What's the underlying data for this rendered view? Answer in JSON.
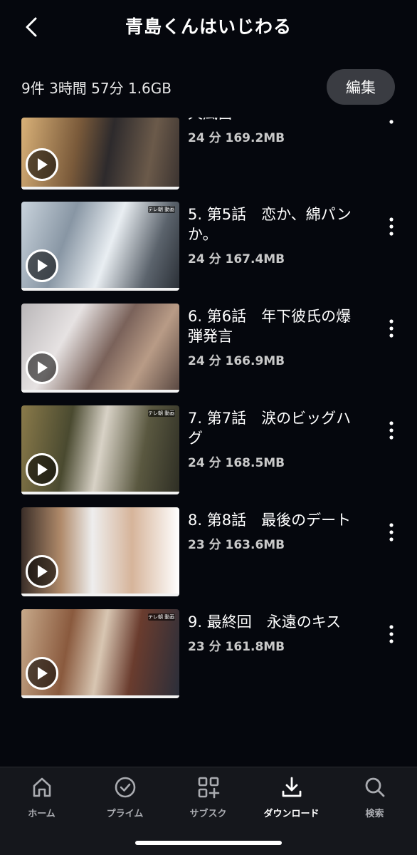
{
  "header": {
    "title": "青島くんはいじわる"
  },
  "summary": {
    "text": "9件  3時間 57分  1.6GB",
    "edit_label": "編集"
  },
  "episodes": [
    {
      "title": "天風呂",
      "meta": "24 分 169.2MB",
      "has_badge": false
    },
    {
      "title": "5. 第5話　恋か、綿パンか。",
      "meta": "24 分 167.4MB",
      "has_badge": true
    },
    {
      "title": "6. 第6話　年下彼氏の爆弾発言",
      "meta": "24 分 166.9MB",
      "has_badge": false
    },
    {
      "title": "7. 第7話　涙のビッグハグ",
      "meta": "24 分 168.5MB",
      "has_badge": true
    },
    {
      "title": "8. 第8話　最後のデート",
      "meta": "23 分 163.6MB",
      "has_badge": false
    },
    {
      "title": "9. 最終回　永遠のキス",
      "meta": "23 分 161.8MB",
      "has_badge": true
    }
  ],
  "badge_text": "テレ朝 動画",
  "tabs": [
    {
      "label": "ホーム",
      "icon": "home-icon"
    },
    {
      "label": "プライム",
      "icon": "check-circle-icon"
    },
    {
      "label": "サブスク",
      "icon": "grid-plus-icon"
    },
    {
      "label": "ダウンロード",
      "icon": "download-icon",
      "active": true
    },
    {
      "label": "検索",
      "icon": "search-icon"
    }
  ],
  "colors": {
    "background": "#05070d",
    "tabbar": "#15171c",
    "edit_button": "#3a3c42"
  }
}
